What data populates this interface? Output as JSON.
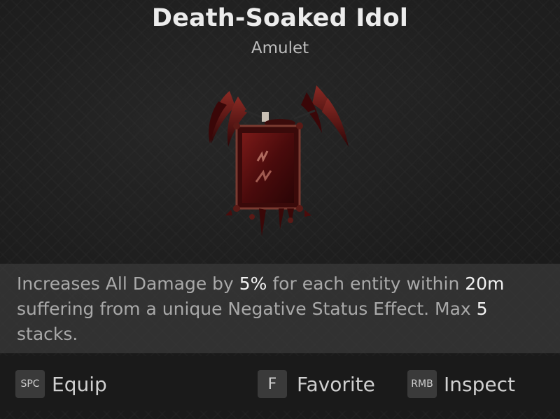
{
  "item": {
    "name": "Death-Soaked Idol",
    "type": "Amulet",
    "icon": "blood-idol-amulet-icon"
  },
  "description": {
    "part1": "Increases All Damage by ",
    "value1": "5%",
    "part2": " for each entity within ",
    "value2": "20m",
    "part3": " suffering from a unique Negative Status Effect. Max ",
    "value3": "5",
    "part4": " stacks."
  },
  "actions": [
    {
      "key": "SPC",
      "label": "Equip"
    },
    {
      "key": "F",
      "label": "Favorite"
    },
    {
      "key": "RMB",
      "label": "Inspect"
    }
  ],
  "colors": {
    "highlight": "#f2f2f2",
    "body_text": "#a9a9a9",
    "idol_red": "#5a0f10"
  }
}
